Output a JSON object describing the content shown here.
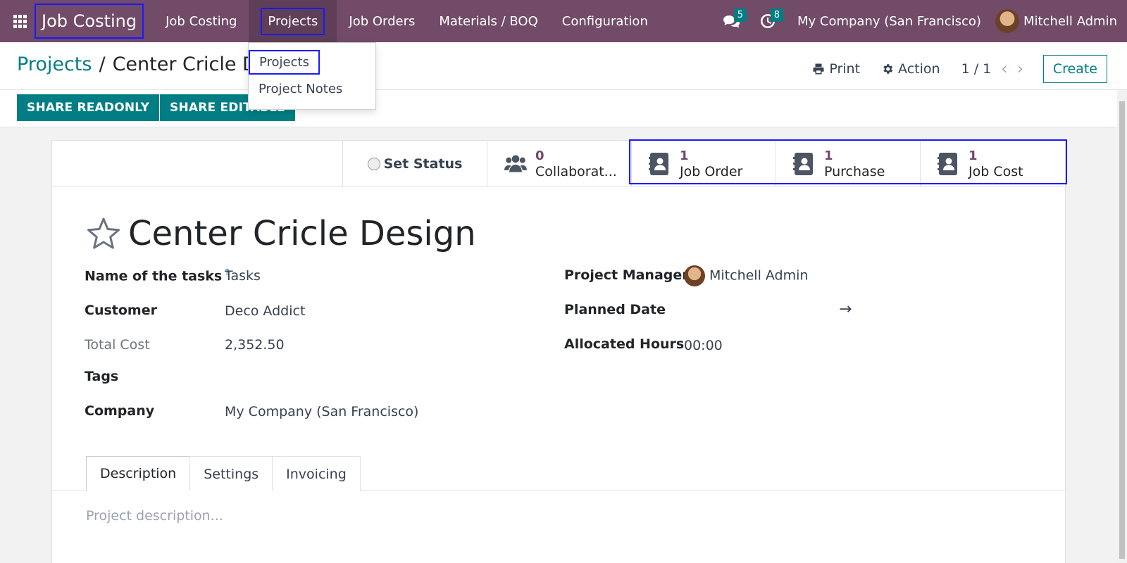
{
  "navbar": {
    "brand": "Job Costing",
    "menu": [
      "Job Costing",
      "Projects",
      "Job Orders",
      "Materials / BOQ",
      "Configuration"
    ],
    "messages_count": "5",
    "activities_count": "8",
    "company": "My Company (San Francisco)",
    "user": "Mitchell Admin"
  },
  "dropdown": {
    "items": [
      "Projects",
      "Project Notes"
    ]
  },
  "control_panel": {
    "breadcrumb_parent": "Projects",
    "breadcrumb_separator": "/",
    "breadcrumb_current": "Center Cricle Design",
    "print_label": "Print",
    "action_label": "Action",
    "pager": "1 / 1",
    "create_label": "Create"
  },
  "statusbar": {
    "share_readonly": "SHARE READONLY",
    "share_editable": "SHARE EDITABLE"
  },
  "button_box": {
    "set_status": "Set Status",
    "collaborators": {
      "count": "0",
      "label": "Collaborat..."
    },
    "job_order": {
      "count": "1",
      "label": "Job Order"
    },
    "purchase": {
      "count": "1",
      "label": "Purchase"
    },
    "job_cost": {
      "count": "1",
      "label": "Job Cost"
    }
  },
  "form": {
    "title": "Center Cricle Design",
    "tasks_label": "Name of the tasks",
    "tasks_help": "?",
    "tasks_value": "Tasks",
    "customer_label": "Customer",
    "customer_value": "Deco Addict",
    "total_cost_label": "Total Cost",
    "total_cost_value": "2,352.50",
    "tags_label": "Tags",
    "company_label": "Company",
    "company_value": "My Company (San Francisco)",
    "pm_label": "Project Manager",
    "pm_value": "Mitchell Admin",
    "planned_date_label": "Planned Date",
    "planned_date_arrow": "→",
    "allocated_hours_label": "Allocated Hours",
    "allocated_hours_value": "00:00"
  },
  "tabs": [
    "Description",
    "Settings",
    "Invoicing"
  ],
  "description_placeholder": "Project description..."
}
